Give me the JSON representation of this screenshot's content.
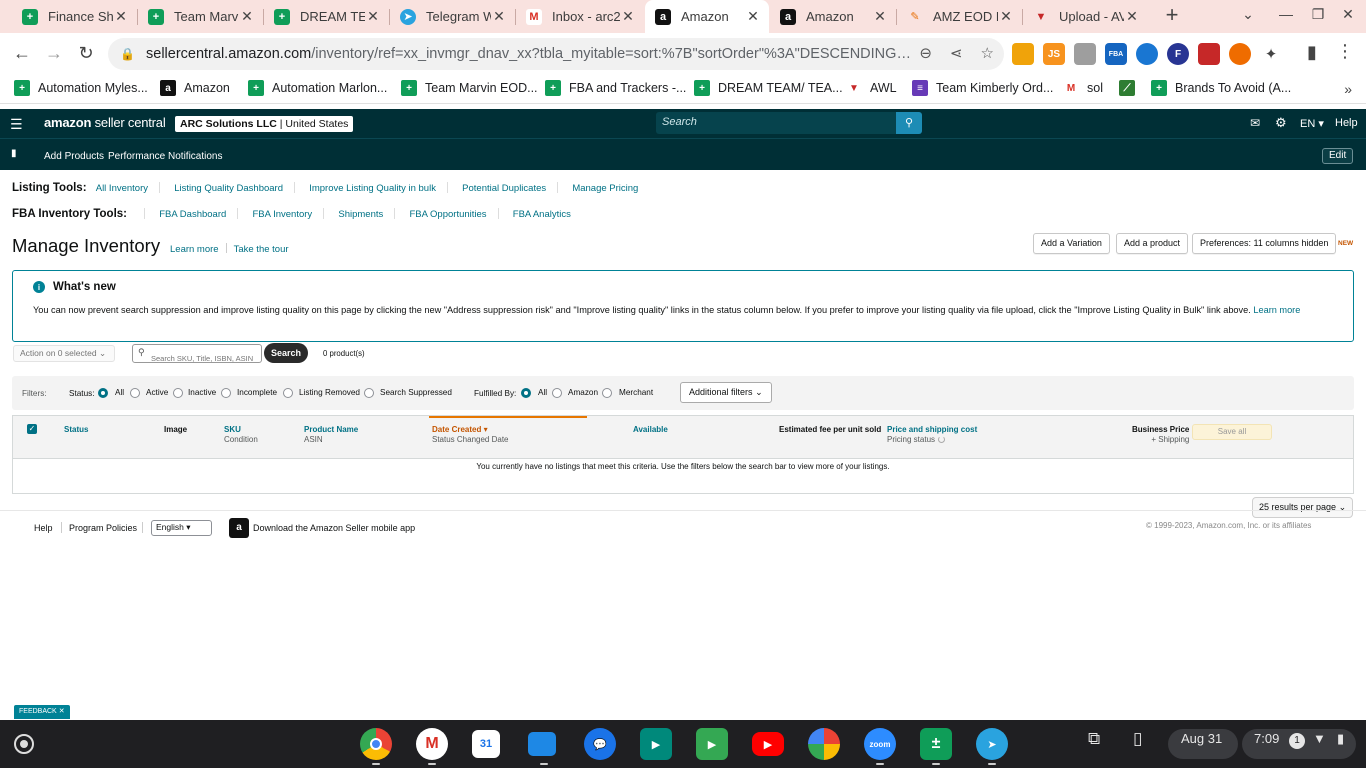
{
  "browser": {
    "tabs": [
      {
        "title": "Finance Sh",
        "icon": "sheets-icon"
      },
      {
        "title": "Team Marvi",
        "icon": "sheets-icon"
      },
      {
        "title": "DREAM TEA",
        "icon": "sheets-icon"
      },
      {
        "title": "Telegram W",
        "icon": "telegram-icon"
      },
      {
        "title": "Inbox - arc2",
        "icon": "gmail-icon"
      },
      {
        "title": "Amazon",
        "icon": "amazon-icon"
      },
      {
        "title": "Amazon",
        "icon": "amazon-icon"
      },
      {
        "title": "AMZ EOD R",
        "icon": "pencil-icon"
      },
      {
        "title": "Upload - AV",
        "icon": "shield-icon"
      }
    ],
    "url_host": "sellercentral.amazon.com",
    "url_path": "/inventory/ref=xx_invmgr_dnav_xx?tbla_myitable=sort:%7B\"sortOrder\"%3A\"DESCENDING\"%2C\"...",
    "bookmarks": [
      {
        "label": "Automation Myles...",
        "icon": "sheets-icon"
      },
      {
        "label": "Amazon",
        "icon": "amazon-icon"
      },
      {
        "label": "Automation Marlon...",
        "icon": "sheets-icon"
      },
      {
        "label": "Team Marvin EOD...",
        "icon": "sheets-icon"
      },
      {
        "label": "FBA and Trackers -...",
        "icon": "sheets-icon"
      },
      {
        "label": "DREAM TEAM/ TEA...",
        "icon": "sheets-icon"
      },
      {
        "label": "AWL",
        "icon": "shield-icon"
      },
      {
        "label": "Team Kimberly Ord...",
        "icon": "forms-icon"
      },
      {
        "label": "sol",
        "icon": "gmail-icon"
      },
      {
        "label": "Brands To Avoid (A...",
        "icon": "sheets-icon"
      }
    ],
    "extensions": [
      {
        "label": "",
        "color": "#f0a30a"
      },
      {
        "label": "JS",
        "color": "#f7931e"
      },
      {
        "label": "",
        "color": "#9e9e9e"
      },
      {
        "label": "FBA",
        "color": "#1565c0"
      },
      {
        "label": "",
        "color": "#1976d2"
      },
      {
        "label": "F",
        "color": "#283593"
      },
      {
        "label": "",
        "color": "#c62828"
      },
      {
        "label": "",
        "color": "#ef6c00"
      }
    ]
  },
  "seller_central": {
    "logo_bold": "amazon",
    "logo_rest": " seller central",
    "account_name": "ARC Solutions LLC",
    "account_region": "United States",
    "search_placeholder": "Search",
    "lang": "EN",
    "help": "Help",
    "sub_links": [
      "Add Products",
      "Performance Notifications"
    ],
    "edit": "Edit"
  },
  "listing_tools": {
    "label": "Listing Tools:",
    "links": [
      "All Inventory",
      "Listing Quality Dashboard",
      "Improve Listing Quality in bulk",
      "Potential Duplicates",
      "Manage Pricing"
    ]
  },
  "fba_tools": {
    "label": "FBA Inventory Tools:",
    "links": [
      "FBA Dashboard",
      "FBA Inventory",
      "Shipments",
      "FBA Opportunities",
      "FBA Analytics"
    ]
  },
  "page": {
    "title": "Manage Inventory",
    "learn_more": "Learn more",
    "take_tour": "Take the tour",
    "add_variation": "Add a Variation",
    "add_product": "Add a product",
    "preferences": "Preferences: 11 columns hidden",
    "new_badge": "NEW"
  },
  "whats_new": {
    "title": "What's new",
    "body": "You can now prevent search suppression and improve listing quality on this page by clicking the new \"Address suppression risk\" and \"Improve listing quality\" links in the status column below. If you prefer to improve your listing quality via file upload, click the \"Improve Listing Quality in Bulk\" link above.",
    "link": "Learn more"
  },
  "actions": {
    "action_dropdown": "Action on 0 selected",
    "search_placeholder": "Search SKU, Title, ISBN, ASIN",
    "search_button": "Search",
    "product_count": "0 product(s)"
  },
  "filters": {
    "label": "Filters:",
    "status_label": "Status:",
    "status_options": [
      "All",
      "Active",
      "Inactive",
      "Incomplete",
      "Listing Removed",
      "Search Suppressed"
    ],
    "status_selected": "All",
    "fulfilled_label": "Fulfilled By:",
    "fulfilled_options": [
      "All",
      "Amazon",
      "Merchant"
    ],
    "fulfilled_selected": "All",
    "additional": "Additional filters"
  },
  "table": {
    "columns": [
      {
        "main": "Status",
        "sub": ""
      },
      {
        "main": "Image",
        "sub": ""
      },
      {
        "main": "SKU",
        "sub": "Condition"
      },
      {
        "main": "Product Name",
        "sub": "ASIN"
      },
      {
        "main": "Date Created",
        "sub": "Status Changed Date"
      },
      {
        "main": "Available",
        "sub": ""
      },
      {
        "main": "Estimated fee per unit sold",
        "sub": ""
      },
      {
        "main": "Price and shipping cost",
        "sub": "Pricing status"
      },
      {
        "main": "Business Price",
        "sub": "+ Shipping"
      }
    ],
    "save_all": "Save all",
    "empty_message": "You currently have no listings that meet this criteria. Use the filters below the search bar to view more of your listings.",
    "per_page": "25 results per page"
  },
  "footer": {
    "help": "Help",
    "program_policies": "Program Policies",
    "language": "English",
    "app_download": "Download the Amazon Seller mobile app",
    "copyright": "© 1999-2023, Amazon.com, Inc. or its affiliates",
    "feedback": "FEEDBACK"
  },
  "shelf": {
    "apps": [
      {
        "name": "chrome",
        "color": "#4285f4"
      },
      {
        "name": "gmail",
        "color": "#ffffff"
      },
      {
        "name": "calendar",
        "color": "#1a73e8"
      },
      {
        "name": "files",
        "color": "#1e88e5"
      },
      {
        "name": "messages",
        "color": "#1a73e8"
      },
      {
        "name": "meet",
        "color": "#00897b"
      },
      {
        "name": "play",
        "color": "#34a853"
      },
      {
        "name": "youtube",
        "color": "#ff0000"
      },
      {
        "name": "photos",
        "color": "#fbbc04"
      },
      {
        "name": "zoom",
        "color": "#2d8cff"
      },
      {
        "name": "sheets",
        "color": "#0f9d58"
      },
      {
        "name": "telegram",
        "color": "#2aa3df"
      }
    ],
    "zoom_label": "zoom",
    "calendar_label": "31",
    "date": "Aug 31",
    "time": "7:09",
    "notifications": "1"
  }
}
